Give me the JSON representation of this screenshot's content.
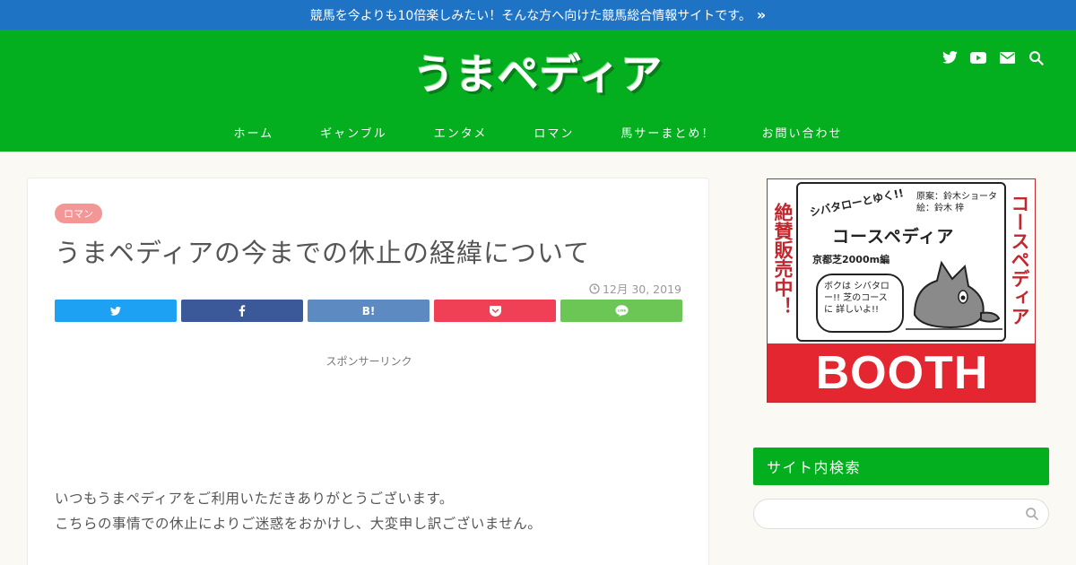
{
  "topbar": {
    "text": "競馬を今よりも10倍楽しみたい！そんな方へ向けた競馬総合情報サイトです。",
    "chevron": "»"
  },
  "header": {
    "logo": "うまペディア",
    "icons": [
      "twitter-icon",
      "youtube-icon",
      "mail-icon",
      "search-icon"
    ]
  },
  "nav": {
    "items": [
      "ホーム",
      "ギャンブル",
      "エンタメ",
      "ロマン",
      "馬サーまとめ！",
      "お問い合わせ"
    ]
  },
  "article": {
    "category": "ロマン",
    "title": "うまペディアの今までの休止の経緯について",
    "date": "12月 30, 2019",
    "share_buttons": [
      {
        "name": "twitter",
        "label": "",
        "color": "#1da1f2"
      },
      {
        "name": "facebook",
        "label": "",
        "color": "#3b5998"
      },
      {
        "name": "hatena",
        "label": "B!",
        "color": "#5d8ac1"
      },
      {
        "name": "pocket",
        "label": "",
        "color": "#ef4056"
      },
      {
        "name": "line",
        "label": "",
        "color": "#6cc655"
      }
    ],
    "sponsor_label": "スポンサーリンク",
    "body_lines": [
      "いつもうまペディアをご利用いただきありがとうございます。",
      "こちらの事情での休止によりご迷惑をおかけし、大変申し訳ございません。"
    ]
  },
  "sidebar": {
    "ad": {
      "left_text": "絶賛販売中！",
      "right_text": "コースペディア",
      "comic_tagline": "シバタローとゆく!!",
      "comic_credit_1": "原案：鈴木ショータ",
      "comic_credit_2": "絵：鈴木 梓",
      "comic_title": "コースペディア",
      "comic_subtitle": "京都芝2000m編",
      "bubble_text": "ボクは シバタロー!! 芝のコースに 詳しいよ!!",
      "booth_label": "BOOTH"
    },
    "search_heading": "サイト内検索",
    "search_placeholder": ""
  },
  "colors": {
    "brand_green": "#03ae1f",
    "topbar_blue": "#1f73c4",
    "category_pink": "#f39696",
    "booth_red": "#e3262f"
  }
}
